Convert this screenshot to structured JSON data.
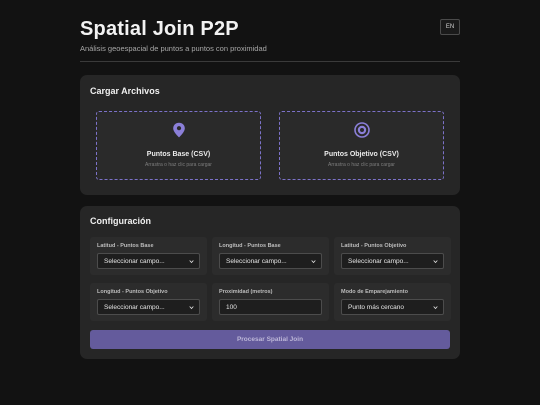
{
  "header": {
    "title": "Spatial Join P2P",
    "subtitle": "Análisis geoespacial de puntos a puntos con proximidad",
    "lang_label": "EN"
  },
  "upload": {
    "title": "Cargar Archivos",
    "base": {
      "label": "Puntos Base (CSV)",
      "hint": "Arrastra o haz clic para cargar",
      "icon": "map-pin-icon"
    },
    "target": {
      "label": "Puntos Objetivo (CSV)",
      "hint": "Arrastra o haz clic para cargar",
      "icon": "target-icon"
    }
  },
  "config": {
    "title": "Configuración",
    "fields": [
      {
        "label": "Latitud - Puntos Base",
        "value": "Seleccionar campo...",
        "kind": "select"
      },
      {
        "label": "Longitud - Puntos Base",
        "value": "Seleccionar campo...",
        "kind": "select"
      },
      {
        "label": "Latitud - Puntos Objetivo",
        "value": "Seleccionar campo...",
        "kind": "select"
      },
      {
        "label": "Longitud - Puntos Objetivo",
        "value": "Seleccionar campo...",
        "kind": "select"
      },
      {
        "label": "Proximidad (metros)",
        "value": "100",
        "kind": "input"
      },
      {
        "label": "Modo de Emparejamiento",
        "value": "Punto más cercano",
        "kind": "select"
      }
    ],
    "process_label": "Procesar Spatial Join"
  },
  "colors": {
    "accent": "#8b7fd8",
    "button": "#645b9c",
    "background": "#121212",
    "card": "#262626"
  }
}
